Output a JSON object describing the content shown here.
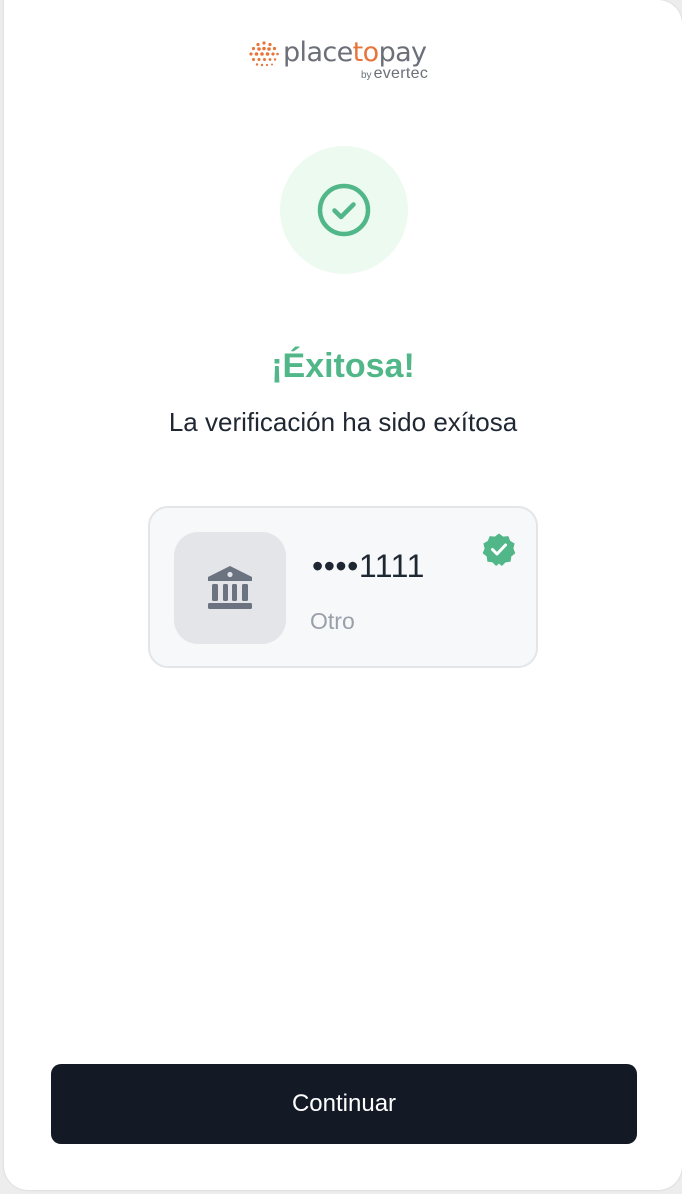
{
  "brand": {
    "name_part1": "place",
    "name_accent": "to",
    "name_part2": "pay",
    "by": "by",
    "parent": "evertec",
    "accent_color": "#e8743b"
  },
  "status": {
    "icon": "check-circle-icon",
    "title": "¡Éxitosa!",
    "message": "La verificación ha sido exítosa",
    "color": "#52b788"
  },
  "account": {
    "icon": "bank-icon",
    "masked_number": "••••1111",
    "type": "Otro",
    "verified_icon": "verified-badge-icon"
  },
  "actions": {
    "continue_label": "Continuar"
  }
}
